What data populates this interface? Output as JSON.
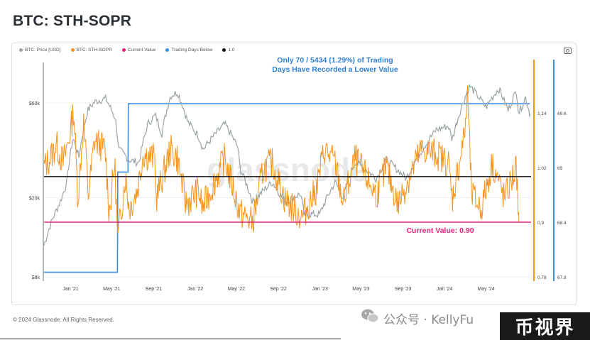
{
  "page": {
    "title": "BTC: STH-SOPR",
    "footer": "© 2024 Glassnode. All Rights Reserved.",
    "watermark_chart": "glassnode",
    "wechat_watermark": "公众号 · KellyFu",
    "stamp": "币视界"
  },
  "legend": [
    {
      "label": "BTC: Price [USD]",
      "color": "#9aa3a6"
    },
    {
      "label": "BTC: STH-SOPR",
      "color": "#f7931a"
    },
    {
      "label": "Current Value",
      "color": "#e6207a"
    },
    {
      "label": "Trading Days Below",
      "color": "#3a8ee6"
    },
    {
      "label": "1.0",
      "color": "#111111"
    }
  ],
  "annotations": {
    "top_line1": "Only 70 / 5434 (1.29%) of Trading",
    "top_line2": "Days Have Recorded a Lower Value",
    "current": "Current Value: 0.90"
  },
  "chart_data": {
    "type": "line",
    "x_tick_labels": [
      "Jan '21",
      "May '21",
      "Sep '21",
      "Jan '22",
      "May '22",
      "Sep '22",
      "Jan '23",
      "May '23",
      "Sep '23",
      "Jan '24",
      "May '24"
    ],
    "x_range": [
      "2020-10-15",
      "2024-09-10"
    ],
    "y_left": {
      "label": "BTC: Price [USD]",
      "scale": "log",
      "ticks": [
        "$8k",
        "$20k",
        "$60k"
      ],
      "tick_values": [
        8000,
        20000,
        60000
      ]
    },
    "y_right_sopr": {
      "ticks": [
        "1.14",
        "1.02",
        "0.9",
        "0.78"
      ],
      "range": [
        0.78,
        1.2
      ]
    },
    "y_right_days": {
      "ticks": [
        "69.6",
        "69",
        "68.4",
        "67.8"
      ]
    },
    "reference_lines": {
      "sopr_one": 1.0,
      "current_value": 0.9
    },
    "series": [
      {
        "name": "BTC: Price [USD]",
        "color": "#9aa3a6",
        "points": [
          [
            "2020-10-15",
            11500
          ],
          [
            "2020-11-05",
            15000
          ],
          [
            "2020-12-01",
            19000
          ],
          [
            "2020-12-20",
            23500
          ],
          [
            "2021-01-08",
            40000
          ],
          [
            "2021-01-25",
            32000
          ],
          [
            "2021-02-20",
            55000
          ],
          [
            "2021-03-13",
            61000
          ],
          [
            "2021-04-14",
            63000
          ],
          [
            "2021-05-12",
            50000
          ],
          [
            "2021-05-22",
            35000
          ],
          [
            "2021-06-22",
            31000
          ],
          [
            "2021-07-20",
            30000
          ],
          [
            "2021-08-15",
            47000
          ],
          [
            "2021-09-06",
            52000
          ],
          [
            "2021-09-25",
            42000
          ],
          [
            "2021-10-20",
            65000
          ],
          [
            "2021-11-10",
            68000
          ],
          [
            "2021-12-10",
            48000
          ],
          [
            "2022-01-10",
            41000
          ],
          [
            "2022-01-24",
            35000
          ],
          [
            "2022-03-28",
            47000
          ],
          [
            "2022-05-05",
            36000
          ],
          [
            "2022-05-12",
            28000
          ],
          [
            "2022-06-18",
            19000
          ],
          [
            "2022-08-14",
            24000
          ],
          [
            "2022-09-20",
            19000
          ],
          [
            "2022-11-05",
            21000
          ],
          [
            "2022-11-15",
            16500
          ],
          [
            "2022-12-31",
            16500
          ],
          [
            "2023-02-15",
            24000
          ],
          [
            "2023-03-10",
            20000
          ],
          [
            "2023-04-14",
            30500
          ],
          [
            "2023-06-15",
            25000
          ],
          [
            "2023-07-14",
            31000
          ],
          [
            "2023-09-11",
            25000
          ],
          [
            "2023-10-25",
            34500
          ],
          [
            "2023-12-08",
            44000
          ],
          [
            "2024-01-12",
            46000
          ],
          [
            "2024-01-23",
            39000
          ],
          [
            "2024-03-14",
            73000
          ],
          [
            "2024-05-01",
            57000
          ],
          [
            "2024-06-07",
            71000
          ],
          [
            "2024-07-05",
            55000
          ],
          [
            "2024-07-29",
            69000
          ],
          [
            "2024-08-05",
            53000
          ],
          [
            "2024-08-25",
            64000
          ],
          [
            "2024-09-06",
            53000
          ]
        ]
      },
      {
        "name": "BTC: STH-SOPR",
        "color": "#f7931a",
        "points": [
          [
            "2020-10-15",
            1.02
          ],
          [
            "2020-11-01",
            1.04
          ],
          [
            "2020-11-20",
            1.07
          ],
          [
            "2020-12-10",
            1.03
          ],
          [
            "2021-01-01",
            1.1
          ],
          [
            "2021-01-10",
            1.15
          ],
          [
            "2021-01-22",
            0.95
          ],
          [
            "2021-02-08",
            1.12
          ],
          [
            "2021-02-22",
            0.96
          ],
          [
            "2021-03-12",
            1.08
          ],
          [
            "2021-04-12",
            1.06
          ],
          [
            "2021-04-24",
            0.92
          ],
          [
            "2021-05-10",
            1.03
          ],
          [
            "2021-05-19",
            0.86
          ],
          [
            "2021-06-10",
            1.0
          ],
          [
            "2021-06-22",
            0.93
          ],
          [
            "2021-07-15",
            0.97
          ],
          [
            "2021-08-01",
            1.05
          ],
          [
            "2021-09-05",
            1.04
          ],
          [
            "2021-09-08",
            0.95
          ],
          [
            "2021-10-20",
            1.06
          ],
          [
            "2021-11-10",
            1.04
          ],
          [
            "2021-12-04",
            0.94
          ],
          [
            "2022-01-10",
            0.97
          ],
          [
            "2022-01-22",
            0.93
          ],
          [
            "2022-03-28",
            1.04
          ],
          [
            "2022-05-12",
            0.92
          ],
          [
            "2022-06-18",
            0.9
          ],
          [
            "2022-07-20",
            1.02
          ],
          [
            "2022-08-14",
            1.03
          ],
          [
            "2022-09-20",
            0.95
          ],
          [
            "2022-11-09",
            0.91
          ],
          [
            "2022-12-20",
            0.97
          ],
          [
            "2023-01-14",
            1.06
          ],
          [
            "2023-02-15",
            1.03
          ],
          [
            "2023-03-10",
            0.94
          ],
          [
            "2023-04-14",
            1.04
          ],
          [
            "2023-06-15",
            0.96
          ],
          [
            "2023-07-14",
            1.02
          ],
          [
            "2023-08-17",
            0.94
          ],
          [
            "2023-10-25",
            1.06
          ],
          [
            "2023-12-08",
            1.05
          ],
          [
            "2024-01-12",
            1.03
          ],
          [
            "2024-01-23",
            0.95
          ],
          [
            "2024-02-28",
            1.09
          ],
          [
            "2024-03-08",
            1.18
          ],
          [
            "2024-03-20",
            0.96
          ],
          [
            "2024-04-17",
            0.93
          ],
          [
            "2024-05-20",
            1.03
          ],
          [
            "2024-06-24",
            0.95
          ],
          [
            "2024-07-29",
            1.02
          ],
          [
            "2024-08-05",
            0.9
          ]
        ]
      },
      {
        "name": "Trading Days Below",
        "color": "#3a8ee6",
        "points": [
          [
            "2020-10-15",
            67.85
          ],
          [
            "2021-05-18",
            67.85
          ],
          [
            "2021-05-19",
            68.95
          ],
          [
            "2021-06-18",
            68.95
          ],
          [
            "2021-06-19",
            69.7
          ],
          [
            "2024-09-06",
            69.7
          ]
        ]
      }
    ]
  }
}
